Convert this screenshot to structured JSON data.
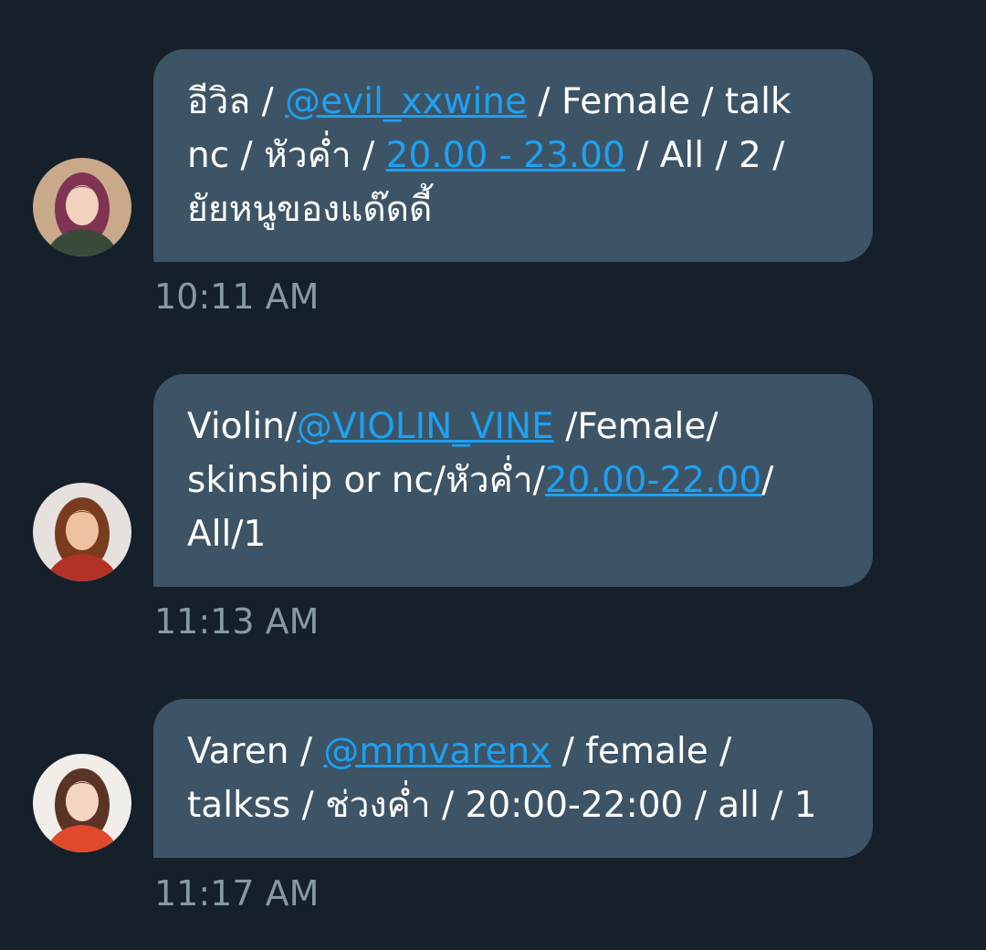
{
  "messages": [
    {
      "avatar": {
        "bg": "#c9a98a",
        "hair": "#7e3452",
        "skin": "#f1d2bf",
        "outfit": "#3a4a3a"
      },
      "lines": [
        [
          {
            "t": "อีวิล / "
          },
          {
            "link": "@evil_xxwine"
          },
          {
            "t": " / Female / talk"
          }
        ],
        [
          {
            "t": "nc / หัวค่ำ / "
          },
          {
            "link": "20.00 - 23.00"
          },
          {
            "t": " / All / 2 /"
          }
        ],
        [
          {
            "t": "ยัยหนูของแด๊ดดี้"
          }
        ]
      ],
      "time": "10:11 AM"
    },
    {
      "avatar": {
        "bg": "#e6e1dc",
        "hair": "#7a3c1f",
        "skin": "#efc1a0",
        "outfit": "#b23225"
      },
      "lines": [
        [
          {
            "t": "Violin/"
          },
          {
            "link": "@VIOLIN_VINE"
          },
          {
            "t": " /Female/"
          }
        ],
        [
          {
            "t": "skinship or nc/หัวค่ำ/"
          },
          {
            "link": "20.00-22.00"
          },
          {
            "t": "/"
          }
        ],
        [
          {
            "t": "All/1"
          }
        ]
      ],
      "time": "11:13 AM"
    },
    {
      "avatar": {
        "bg": "#f1ede8",
        "hair": "#5a3424",
        "skin": "#f4d5c4",
        "outfit": "#e0492a"
      },
      "lines": [
        [
          {
            "t": "Varen / "
          },
          {
            "link": "@mmvarenx"
          },
          {
            "t": " / female /"
          }
        ],
        [
          {
            "t": "talkss / ช่วงค่ำ / 20:00-22:00 / all / 1"
          }
        ]
      ],
      "time": "11:17 AM"
    }
  ]
}
